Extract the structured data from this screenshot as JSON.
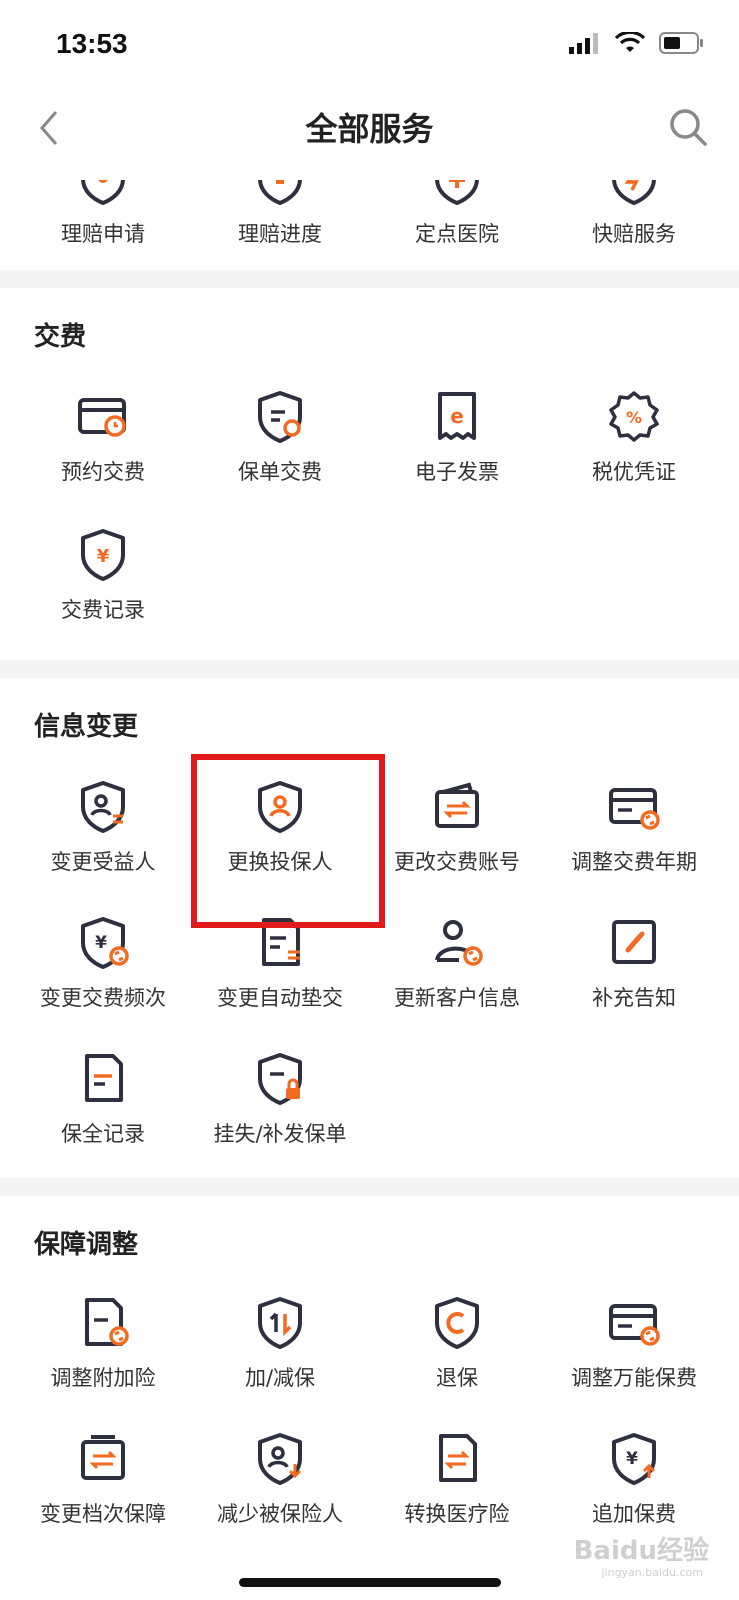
{
  "status": {
    "time": "13:53"
  },
  "nav": {
    "title": "全部服务"
  },
  "colors": {
    "accent": "#f36b21",
    "dark": "#2e2f3f",
    "highlight": "#e11b1b"
  },
  "top_row": [
    {
      "label": "理赔申请",
      "icon": "claim-apply-icon"
    },
    {
      "label": "理赔进度",
      "icon": "claim-progress-icon"
    },
    {
      "label": "定点医院",
      "icon": "hospital-icon"
    },
    {
      "label": "快赔服务",
      "icon": "fast-claim-icon"
    }
  ],
  "sections": [
    {
      "title": "交费",
      "items": [
        {
          "label": "预约交费",
          "icon": "scheduled-payment-icon"
        },
        {
          "label": "保单交费",
          "icon": "policy-payment-icon"
        },
        {
          "label": "电子发票",
          "icon": "e-invoice-icon"
        },
        {
          "label": "税优凭证",
          "icon": "tax-voucher-icon"
        },
        {
          "label": "交费记录",
          "icon": "payment-record-icon"
        }
      ]
    },
    {
      "title": "信息变更",
      "items": [
        {
          "label": "变更受益人",
          "icon": "change-beneficiary-icon"
        },
        {
          "label": "更换投保人",
          "icon": "change-policyholder-icon"
        },
        {
          "label": "更改交费账号",
          "icon": "change-account-icon"
        },
        {
          "label": "调整交费年期",
          "icon": "adjust-term-icon"
        },
        {
          "label": "变更交费频次",
          "icon": "change-frequency-icon"
        },
        {
          "label": "变更自动垫交",
          "icon": "auto-advance-icon"
        },
        {
          "label": "更新客户信息",
          "icon": "update-customer-icon"
        },
        {
          "label": "补充告知",
          "icon": "supplement-notice-icon"
        },
        {
          "label": "保全记录",
          "icon": "preservation-record-icon"
        },
        {
          "label": "挂失/补发保单",
          "icon": "lost-policy-icon"
        }
      ]
    },
    {
      "title": "保障调整",
      "items": [
        {
          "label": "调整附加险",
          "icon": "adjust-rider-icon"
        },
        {
          "label": "加/减保",
          "icon": "increase-decrease-icon"
        },
        {
          "label": "退保",
          "icon": "surrender-icon"
        },
        {
          "label": "调整万能保费",
          "icon": "adjust-universal-icon"
        },
        {
          "label": "变更档次保障",
          "icon": "change-tier-icon"
        },
        {
          "label": "减少被保险人",
          "icon": "reduce-insured-icon"
        },
        {
          "label": "转换医疗险",
          "icon": "convert-medical-icon"
        },
        {
          "label": "追加保费",
          "icon": "add-premium-icon"
        }
      ]
    }
  ],
  "watermark": {
    "main": "Baidu经验",
    "sub": "jingyan.baidu.com"
  }
}
